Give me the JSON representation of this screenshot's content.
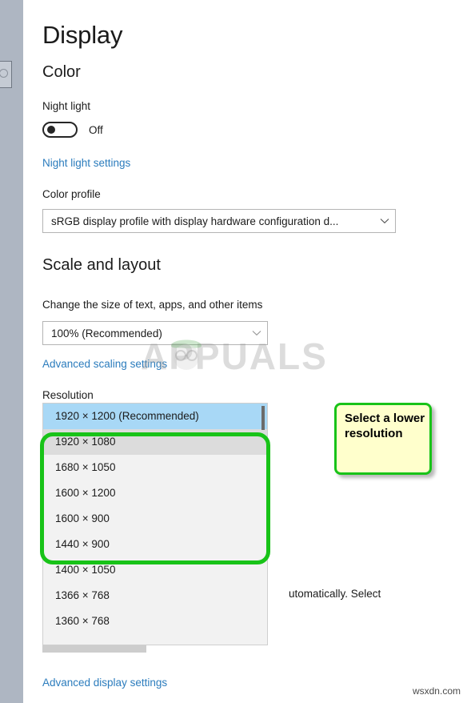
{
  "window": {
    "page_title": "Display"
  },
  "sidebar": {
    "partial_item_icon": "circle-icon"
  },
  "color_section": {
    "heading": "Color",
    "night_light_label": "Night light",
    "night_light_state": "Off",
    "night_light_settings_link": "Night light settings",
    "color_profile_label": "Color profile",
    "color_profile_value": "sRGB display profile with display hardware configuration d..."
  },
  "scale_section": {
    "heading": "Scale and layout",
    "change_size_label": "Change the size of text, apps, and other items",
    "change_size_value": "100% (Recommended)",
    "advanced_scaling_link": "Advanced scaling settings",
    "resolution_label": "Resolution",
    "resolution_options": [
      {
        "label": "1920 × 1200 (Recommended)",
        "state": "selected"
      },
      {
        "label": "1920 × 1080",
        "state": "hover"
      },
      {
        "label": "1680 × 1050",
        "state": "normal"
      },
      {
        "label": "1600 × 1200",
        "state": "normal"
      },
      {
        "label": "1600 × 900",
        "state": "normal"
      },
      {
        "label": "1440 × 900",
        "state": "normal"
      },
      {
        "label": "1400 × 1050",
        "state": "normal"
      },
      {
        "label": "1366 × 768",
        "state": "normal"
      },
      {
        "label": "1360 × 768",
        "state": "normal"
      }
    ],
    "occluded_paragraph": "utomatically. Select"
  },
  "callout": {
    "text": "Select a lower resolution",
    "border_color": "#18c318",
    "background_color": "#ffffcc"
  },
  "highlight": {
    "border_color": "#18c318"
  },
  "footer": {
    "advanced_display_link": "Advanced display settings"
  },
  "watermarks": {
    "brand": "APPUALS",
    "site": "wsxdn.com"
  },
  "colors": {
    "accent_link": "#2b7cbd",
    "selection_blue": "#a8d8f6",
    "hover_gray": "#dcdcdc",
    "sidebar": "#aeb6c2"
  }
}
